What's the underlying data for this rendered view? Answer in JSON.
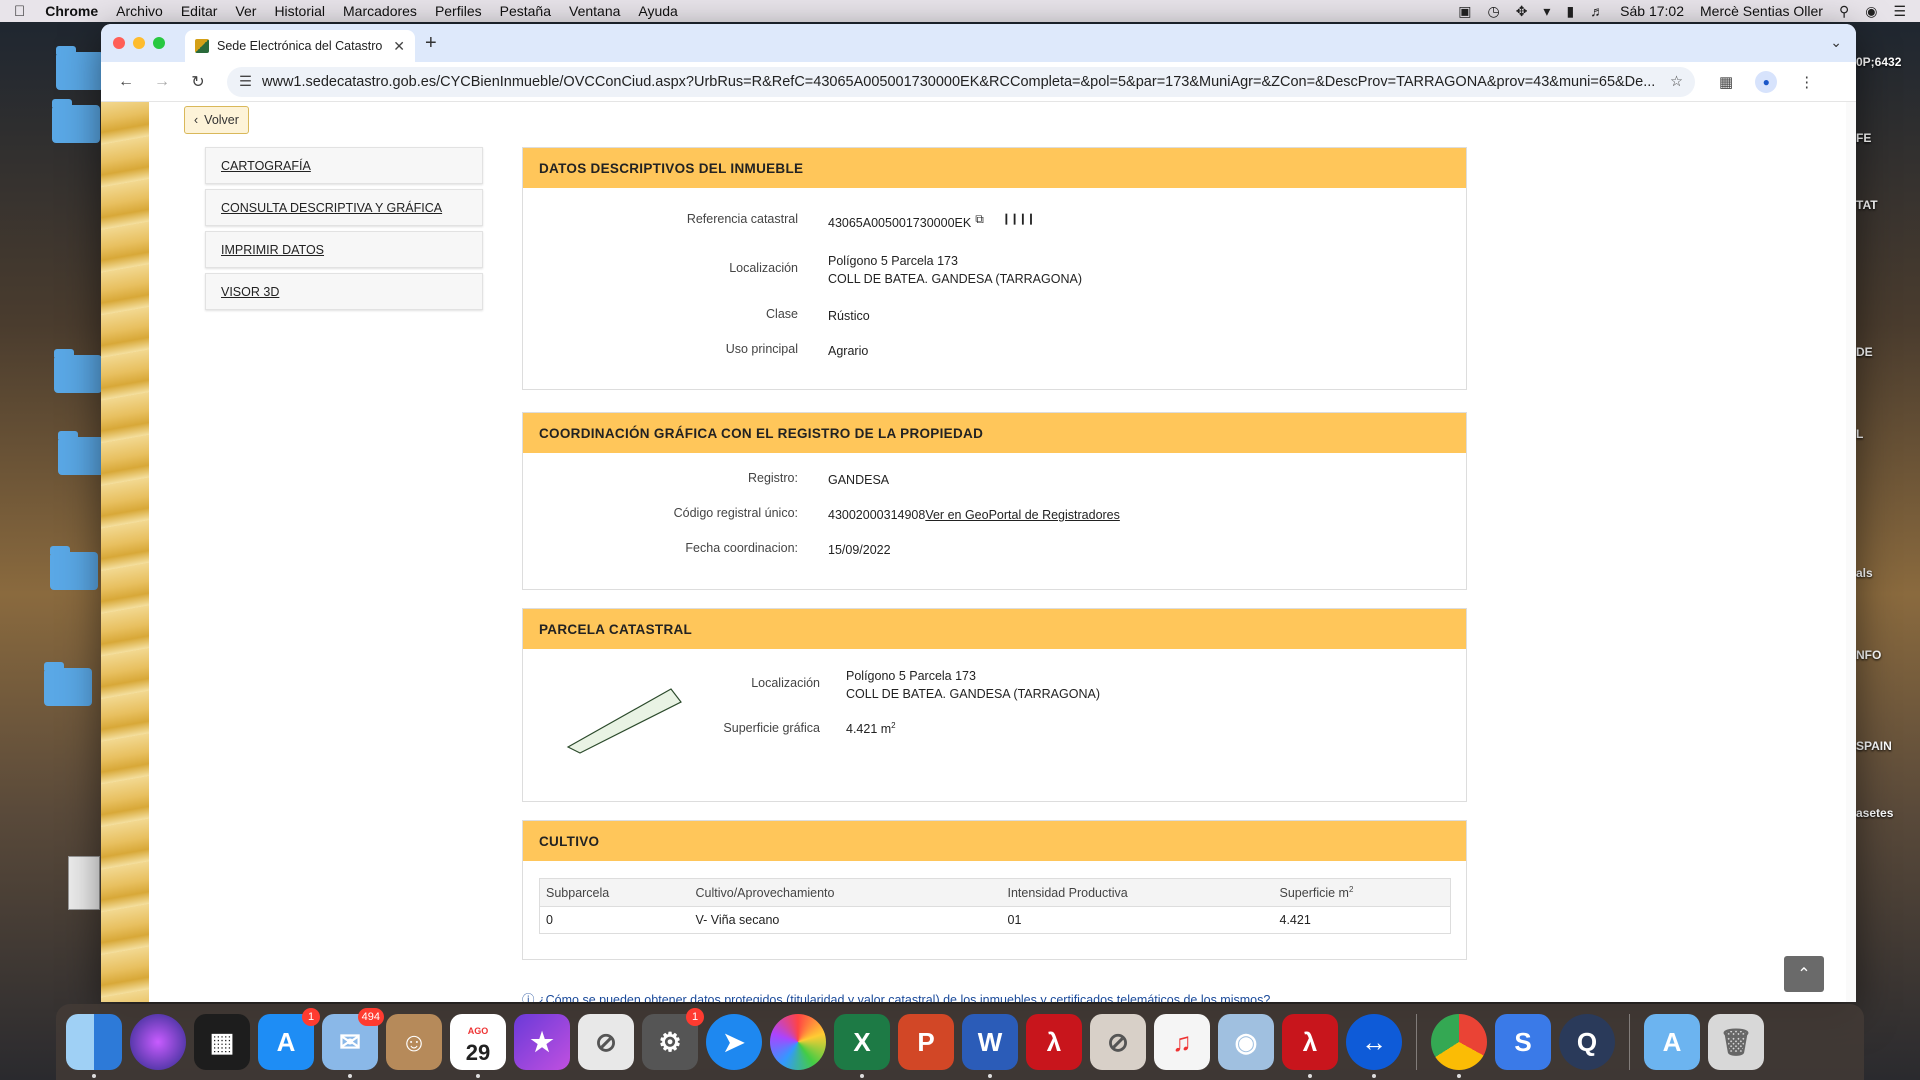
{
  "menubar": {
    "app": "Chrome",
    "items": [
      "Archivo",
      "Editar",
      "Ver",
      "Historial",
      "Marcadores",
      "Perfiles",
      "Pestaña",
      "Ventana",
      "Ayuda"
    ],
    "clock": "Sáb 17:02",
    "user": "Mercè Sentias Oller"
  },
  "desktop": {
    "labels": [
      "0P;6432",
      "FE",
      "TAT",
      "DE",
      "L",
      "als",
      "NFO",
      "SPAIN",
      "asetes"
    ]
  },
  "browser": {
    "tab_title": "Sede Electrónica del Catastro",
    "url": "www1.sedecatastro.gob.es/CYCBienInmueble/OVCConCiud.aspx?UrbRus=R&RefC=43065A005001730000EK&RCCompleta=&pol=5&par=173&MuniAgr=&ZCon=&DescProv=TARRAGONA&prov=43&muni=65&De..."
  },
  "page": {
    "back_label": "Volver",
    "menu": [
      "CARTOGRAFÍA",
      "CONSULTA DESCRIPTIVA Y GRÁFICA",
      "IMPRIMIR DATOS",
      "VISOR 3D"
    ],
    "datos": {
      "header": "DATOS DESCRIPTIVOS DEL INMUEBLE",
      "ref_label": "Referencia catastral",
      "ref_value": "43065A005001730000EK",
      "loc_label": "Localización",
      "loc_line1": "Polígono 5 Parcela 173",
      "loc_line2": "COLL DE BATEA. GANDESA (TARRAGONA)",
      "clase_label": "Clase",
      "clase_value": "Rústico",
      "uso_label": "Uso principal",
      "uso_value": "Agrario"
    },
    "coord": {
      "header": "COORDINACIÓN GRÁFICA CON EL REGISTRO DE LA PROPIEDAD",
      "registro_label": "Registro:",
      "registro_value": "GANDESA",
      "codigo_label": "Código registral único:",
      "codigo_value": "43002000314908",
      "codigo_link": " Ver en GeoPortal de Registradores",
      "fecha_label": "Fecha coordinacion:",
      "fecha_value": "15/09/2022"
    },
    "parcela": {
      "header": "PARCELA CATASTRAL",
      "loc_label": "Localización",
      "loc_line1": "Polígono 5 Parcela 173",
      "loc_line2": "COLL DE BATEA. GANDESA (TARRAGONA)",
      "sup_label": "Superficie gráfica",
      "sup_value": "4.421 m",
      "sup_exp": "2"
    },
    "cultivo": {
      "header": "CULTIVO",
      "columns": [
        "Subparcela",
        "Cultivo/Aprovechamiento",
        "Intensidad Productiva",
        "Superficie m"
      ],
      "col_exp": "2",
      "rows": [
        [
          "0",
          "V- Viña secano",
          "01",
          "4.421"
        ]
      ]
    },
    "faq": "¿Cómo se pueden obtener datos protegidos (titularidad y valor catastral) de los inmuebles y certificados telemáticos de los mismos?"
  },
  "dock": {
    "calendar_month": "AGO",
    "calendar_day": "29",
    "badges": {
      "appstore": "1",
      "mail": "494",
      "settings": "1"
    }
  }
}
